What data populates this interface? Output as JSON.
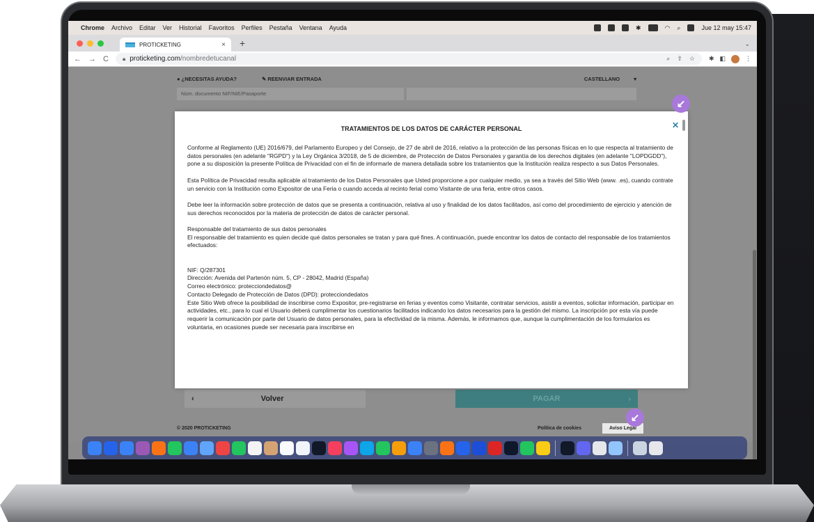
{
  "menubar": {
    "app": "Chrome",
    "items": [
      "Archivo",
      "Editar",
      "Ver",
      "Historial",
      "Favoritos",
      "Perfiles",
      "Pestaña",
      "Ventana",
      "Ayuda"
    ],
    "clock": "Jue 12 may  15:47"
  },
  "tab": {
    "title": "PROTICKETING",
    "close": "×",
    "new_tab": "+"
  },
  "address": {
    "host": "proticketing.com",
    "path": "/nombredetucanal"
  },
  "page": {
    "help": "¿NECESITAS AYUDA?",
    "resend": "REENVIAR ENTRADA",
    "language": "CASTELLANO",
    "doc_field_placeholder": "Núm. documento NIF/NIE/Pasaporte",
    "back_arrow": "‹",
    "back_label": "Volver",
    "pay_label": "PAGAR",
    "pay_arrow": "›",
    "copyright": "© 2020 PROTICKETING",
    "cookies": "Política de cookies",
    "legal": "Aviso Legal"
  },
  "modal": {
    "title": "TRATAMIENTOS DE LOS DATOS DE CARÁCTER PERSONAL",
    "close": "✕",
    "p1": "Conforme al Reglamento (UE) 2016/679, del Parlamento Europeo y del Consejo, de 27 de abril de 2016, relativo a la protección de las personas físicas en lo que respecta al tratamiento de datos personales (en adelante \"RGPD\") y la Ley Orgánica 3/2018, de 5 de diciembre, de Protección de Datos Personales y garantía de los derechos digitales (en adelante \"LOPDGDD\"),            pone a su disposición la presente Política de Privacidad con el fin de informarle de manera detallada sobre los tratamientos que la Institución realiza respecto a sus Datos Personales.",
    "p2": "Esta Política de Privacidad resulta aplicable al tratamiento de los Datos Personales que Usted proporcione a             por cualquier medio, ya sea a través del Sitio Web (www.         .es), cuando contrate un servicio con la Institución como Expositor de una Feria o cuando acceda al recinto ferial como Visitante de una feria, entre otros casos.",
    "p3": "Debe leer la información sobre protección de datos que se presenta a continuación, relativa al uso y finalidad de los datos facilitados, así como del procedimiento de ejercicio y atención de sus derechos reconocidos por la materia de protección de datos de carácter personal.",
    "p4_heading": "Responsable del tratamiento de sus datos personales",
    "p4": "El responsable del tratamiento es quien decide qué datos personales se tratan y para qué fines. A continuación, puede encontrar los datos de contacto del responsable de los tratamientos efectuados:",
    "nif": "NIF: Q/287301",
    "address": "Dirección: Avenida del Partenón núm. 5, CP - 28042, Madrid (España)",
    "email": "Correo electrónico: protecciondedatos@",
    "dpd": "Contacto Delegado de Protección de Datos (DPD): protecciondedatos",
    "p5": "Este Sitio Web ofrece la posibilidad de inscribirse como Expositor, pre-registrarse en ferias y eventos como Visitante, contratar servicios, asistir a eventos, solicitar información, participar en actividades, etc., para lo cual el Usuario deberá cumplimentar los cuestionarios facilitados indicando los datos necesarios para la gestión del mismo. La inscripción por esta vía puede requerir la comunicación por parte del Usuario de datos personales, para la efectividad de la misma. Además, le informamos que, aunque la cumplimentación de los formularios es voluntaria, en ocasiones puede ser necesaria para inscribirse en"
  },
  "badges": {
    "arrow": "↙"
  },
  "colors": {
    "badge": "#a878db",
    "pay_button": "#3f7e80",
    "close_x": "#2f7fa8",
    "overlay": "#8e8e8e",
    "dock_apps": [
      "#3b82f6",
      "#2563eb",
      "#3b82f6",
      "#9b59b6",
      "#f97316",
      "#22c55e",
      "#3b82f6",
      "#60a5fa",
      "#ef4444",
      "#22c55e",
      "#f4f4f5",
      "#d4a373",
      "#f8fafc",
      "#f1f5f9",
      "#111827",
      "#f43f5e",
      "#a855f7",
      "#0ea5e9",
      "#22c55e",
      "#f59e0b",
      "#3b82f6",
      "#6b7280",
      "#f97316",
      "#2563eb",
      "#1d4ed8",
      "#dc2626",
      "#0f172a",
      "#22c55e",
      "#facc15",
      "#111827",
      "#6366f1",
      "#e5e7eb",
      "#93c5fd",
      "#cbd5e1",
      "#e5e7eb"
    ]
  }
}
